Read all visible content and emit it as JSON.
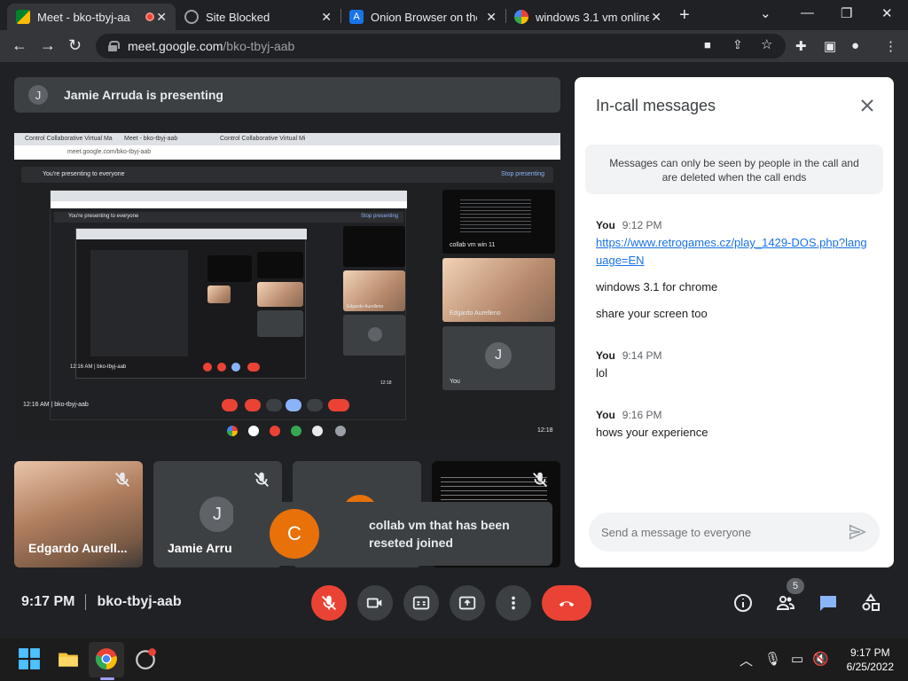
{
  "browser": {
    "tabs": [
      {
        "title": "Meet - bko-tbyj-aa",
        "active": true
      },
      {
        "title": "Site Blocked",
        "active": false
      },
      {
        "title": "Onion Browser on the",
        "active": false
      },
      {
        "title": "windows 3.1 vm online",
        "active": false
      }
    ],
    "url_host": "meet.google.com",
    "url_path": "/bko-tbyj-aab"
  },
  "meet": {
    "presenting_banner": "Jamie Arruda is presenting",
    "presenter_initial": "J",
    "screen_share": {
      "tab_label_1": "Control Collaborative Virtual Ma",
      "tab_label_2": "Meet - bko-tbyj-aab",
      "tab_label_3": "Control Collaborative Virtual Mi",
      "url": "meet.google.com/bko-tbyj-aab",
      "presenting_text": "You're presenting to everyone",
      "stop_text": "Stop presenting",
      "nested_presenting": "You're presenting to everyone",
      "nested_stop": "Stop presenting",
      "tile_collab": "collab vm win 11",
      "tile_edgardo": "Edgardo Aurelleno",
      "tile_you": "You",
      "tile_initial": "J",
      "nested_tile_edgardo": "Edgardo Aurelleno",
      "nested_tile_collab": "collab vm win 11",
      "nested_time": "12:16 AM  |  bko-tbyj-aab",
      "inner_time": "12:16 AM  |  bko-tbyj-aab",
      "nested_clock": "12:18",
      "inner_clock": "12:18"
    },
    "tiles": [
      {
        "name": "Edgardo Aurell...",
        "kind": "video"
      },
      {
        "name": "Jamie Arru",
        "initial": "J",
        "kind": "avatar"
      },
      {
        "name": "",
        "kind": "avatar"
      },
      {
        "name": "",
        "kind": "terminal"
      }
    ],
    "toast": {
      "initial": "C",
      "message": "collab vm that has been reseted joined"
    },
    "meeting_time": "9:17 PM",
    "meeting_code": "bko-tbyj-aab",
    "participant_count": "5",
    "colors": {
      "red": "#ea4335",
      "orange": "#e8710a",
      "blue": "#1a73e8",
      "dark": "#202124"
    }
  },
  "chat": {
    "title": "In-call messages",
    "notice": "Messages can only be seen by people in the call and are deleted when the call ends",
    "groups": [
      {
        "sender": "You",
        "time": "9:12 PM",
        "link": "https://www.retrogames.cz/play_1429-DOS.php?language=EN",
        "lines": [
          "windows 3.1 for chrome",
          "share your screen too"
        ]
      },
      {
        "sender": "You",
        "time": "9:14 PM",
        "lines": [
          "lol"
        ]
      },
      {
        "sender": "You",
        "time": "9:16 PM",
        "lines": [
          "hows your experience"
        ]
      }
    ],
    "composer_placeholder": "Send a message to everyone"
  },
  "taskbar": {
    "time": "9:17 PM",
    "date": "6/25/2022"
  }
}
